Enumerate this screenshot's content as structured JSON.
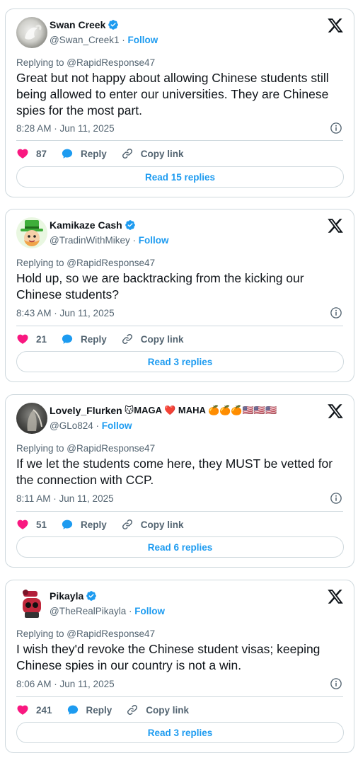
{
  "colors": {
    "accent": "#1d9bf0",
    "like": "#f91880",
    "muted": "#536471",
    "border": "#cfd9de"
  },
  "tweets": [
    {
      "display_name": "Swan Creek",
      "handle": "@Swan_Creek1",
      "follow_label": "Follow",
      "replying_to": "Replying to @RapidResponse47",
      "text": "Great but not happy about allowing Chinese students still being allowed to enter our universities.  They are Chinese spies for the most part.",
      "timestamp": "8:28 AM · Jun 11, 2025",
      "likes": "87",
      "reply_label": "Reply",
      "copy_label": "Copy link",
      "read_replies": "Read 15 replies"
    },
    {
      "display_name": "Kamikaze Cash",
      "handle": "@TradinWithMikey",
      "follow_label": "Follow",
      "replying_to": "Replying to @RapidResponse47",
      "text": "Hold up, so we are backtracking from the kicking our Chinese students?",
      "timestamp": "8:43 AM · Jun 11, 2025",
      "likes": "21",
      "reply_label": "Reply",
      "copy_label": "Copy link",
      "read_replies": "Read 3 replies"
    },
    {
      "display_name": "Lovely_Flurken",
      "name_suffix": "😽MAGA ❤️ MAHA 🍊🍊🍊🇺🇸🇺🇸🇺🇸",
      "handle": "@GLo824",
      "follow_label": "Follow",
      "replying_to": "Replying to @RapidResponse47",
      "text": "If we let the students come here, they MUST be vetted for the connection with CCP.",
      "timestamp": "8:11 AM · Jun 11, 2025",
      "likes": "51",
      "reply_label": "Reply",
      "copy_label": "Copy link",
      "read_replies": "Read 6 replies"
    },
    {
      "display_name": "Pikayla",
      "handle": "@TheRealPikayla",
      "follow_label": "Follow",
      "replying_to": "Replying to @RapidResponse47",
      "text": "I wish they'd revoke the Chinese student visas; keeping Chinese spies in our country is not a win.",
      "timestamp": "8:06 AM · Jun 11, 2025",
      "likes": "241",
      "reply_label": "Reply",
      "copy_label": "Copy link",
      "read_replies": "Read 3 replies"
    }
  ]
}
